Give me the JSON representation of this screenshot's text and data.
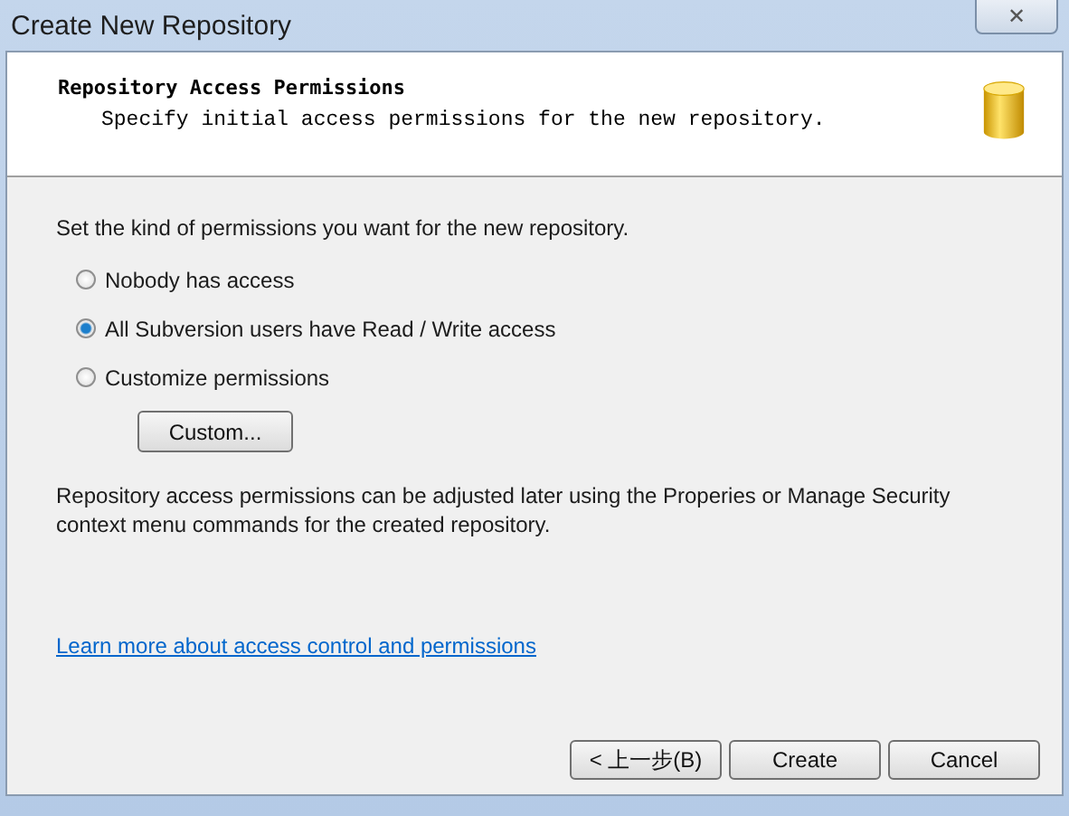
{
  "window": {
    "title": "Create New Repository",
    "close": "✕"
  },
  "header": {
    "title": "Repository Access Permissions",
    "subtitle": "Specify initial access permissions for the new repository."
  },
  "prompt": "Set the kind of permissions you want for the new repository.",
  "options": [
    {
      "label": "Nobody has access",
      "selected": false
    },
    {
      "label": "All Subversion users have Read / Write access",
      "selected": true
    },
    {
      "label": "Customize permissions",
      "selected": false
    }
  ],
  "custom_button": "Custom...",
  "note": "Repository access permissions can be adjusted later using the Properies or Manage Security context menu commands for the created repository.",
  "link": "Learn more about access control and permissions",
  "buttons": [
    "< 上一步(B)",
    "Create",
    "Cancel"
  ]
}
